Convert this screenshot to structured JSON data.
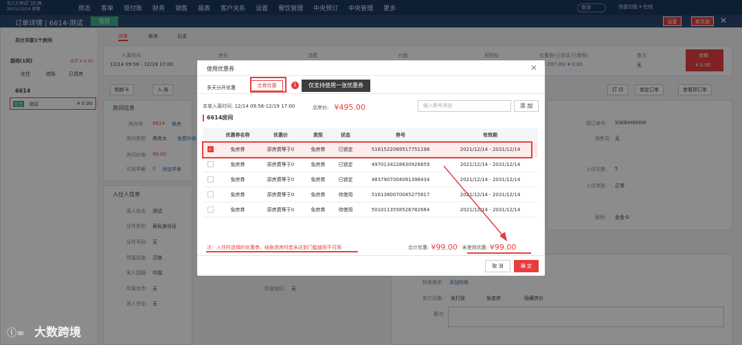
{
  "topnav": {
    "brand": "东三方测试门店(酒... 2021/12/14 星期",
    "menu": [
      "房态",
      "客单",
      "现付账",
      "财务",
      "销售",
      "报表",
      "客户关系",
      "设置",
      "餐饮管理",
      "中央预订",
      "中央管理",
      "更多"
    ],
    "search": "查询",
    "right": "快捷功能  ▾     在线"
  },
  "order": {
    "title": "订单详情 | 6614-测试",
    "status": "在住",
    "btn_settings": "设置",
    "btn_new": "新页面",
    "close": "✕"
  },
  "bg": {
    "tabs": [
      "详单",
      "账务",
      "日志"
    ],
    "left_title": "共计关联1个房间",
    "left_group": "接待(1间)",
    "left_total": "合计 ¥ 0.00",
    "left_filters": [
      "在住",
      "挂账",
      "已退房"
    ],
    "room_no": "6614",
    "room_status": "在住",
    "room_guest": "测试",
    "room_amount": "¥ 0.00",
    "cols": [
      "入离时间",
      "房价",
      "消费",
      "付款",
      "预授权",
      "优惠券(已验证/已使用)",
      "备注"
    ],
    "dates": "12/14 09:56 - 12/19 17:00",
    "coupon_val": "¥ 297.00/ ¥ 0.00",
    "remark": "无",
    "balance_label": "余额",
    "balance": "¥ 0.00",
    "actions_left": [
      "制新卡",
      "入 账"
    ],
    "actions_right": [
      "打 印",
      "锁定订单",
      "查看预订单"
    ],
    "room_info": "房间信息",
    "room_label": "房间号:",
    "room_val": "6614",
    "room_change": "换房",
    "roomtype_label": "房间类型:",
    "roomtype_val": "商务大",
    "roomtype_up": "免费升级",
    "price_label": "房间价格:",
    "price_val": "99.00",
    "pts_label": "可用早餐:",
    "pts_val": "0",
    "pts_add": "添加早餐",
    "guest_info": "入住人信息",
    "g_name_l": "客人姓名:",
    "g_name": "测试",
    "g_idt_l": "证件类型:",
    "g_idt": "居民身份证",
    "g_idn_l": "证件号码:",
    "g_idn": "无",
    "g_nat_l": "所属民族:",
    "g_nat": "汉族",
    "g_cty_l": "客人国籍:",
    "g_cty": "中国",
    "g_area_l": "所属地市:",
    "g_area": "无",
    "g_reg_l": "所属地区:",
    "g_reg": "无",
    "g_addr_l": "客人住址:",
    "g_addr": "无",
    "r_order_l": "预订单号:",
    "r_order": "SSKBIH6S00I",
    "r_sales_l": "销售员:",
    "r_sales": "无",
    "r_days_l": "入住天数:",
    "r_days": "5",
    "r_type_l": "入住类型:",
    "r_type": "正常",
    "r_level_l": "级别:",
    "r_level": "金金卡",
    "r_req_l": "特殊需求:",
    "r_req": "添加特殊",
    "r_other_l": "其它设置:",
    "r_opts": [
      "免打扰",
      "免查房",
      "隐藏房价"
    ],
    "r_rem_l": "备注:"
  },
  "modal": {
    "title": "使用优惠券",
    "close": "✕",
    "tab_multi": "多天分开优惠",
    "tab_coupon": "合券优惠",
    "badge": "1",
    "tooltip": "仅支持使用一张优惠券",
    "stay_label": "本单入离时间:",
    "stay_value": "12/14 09:56-12/19 17:00",
    "total_label": "总房价:",
    "total_value": "¥495.00",
    "search_placeholder": "输入券号添加",
    "add_label": "添 加",
    "room_title": "6614房间",
    "headers": [
      "",
      "优惠券名称",
      "优惠价",
      "类型",
      "状态",
      "券号",
      "有效期"
    ],
    "rows": [
      {
        "checked": true,
        "name": "免房券",
        "price": "原房费等于0",
        "type": "免房券",
        "status": "已锁定",
        "code": "5161522069517751198",
        "valid": "2021/12/14 - 2031/12/14"
      },
      {
        "checked": false,
        "name": "免房券",
        "price": "原房费等于0",
        "type": "免房券",
        "status": "已锁定",
        "code": "4970134228630926659",
        "valid": "2021/12/14 - 2031/12/14"
      },
      {
        "checked": false,
        "name": "免房券",
        "price": "原房费等于0",
        "type": "免房券",
        "status": "已锁定",
        "code": "4837907004091398434",
        "valid": "2021/12/14 - 2031/12/14"
      },
      {
        "checked": false,
        "name": "免房券",
        "price": "原房费等于0",
        "type": "免房券",
        "status": "待使用",
        "code": "5161380070045275817",
        "valid": "2021/12/14 - 2031/12/14"
      },
      {
        "checked": false,
        "name": "免房券",
        "price": "原房费等于0",
        "type": "免房券",
        "status": "待使用",
        "code": "5010113558526782684",
        "valid": "2021/12/14 - 2031/12/14"
      }
    ],
    "note": "注：入住时选择的优惠券，结账退房时若未达到门槛值则不可用",
    "sum_label": "合计优惠:",
    "sum_value": "¥99.00",
    "unused_label": "未使用优惠:",
    "unused_value": "¥99.00",
    "cancel": "取 消",
    "confirm": "确 定"
  },
  "watermark": {
    "logo": "ⓛ∞",
    "text": "大数跨境"
  },
  "colors": {
    "accent": "#e63e3e",
    "nav": "#1d3a5e",
    "status_green": "#3cb38a"
  }
}
